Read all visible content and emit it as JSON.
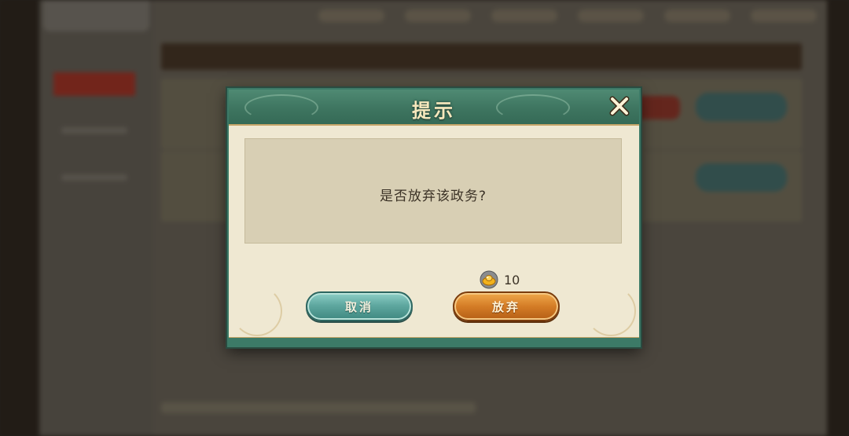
{
  "dialog": {
    "title": "提示",
    "message": "是否放弃该政务?",
    "cost": {
      "icon": "gold-ingot-icon",
      "amount": "10"
    },
    "buttons": {
      "cancel_label": "取消",
      "abandon_label": "放弃"
    }
  },
  "colors": {
    "header_green": "#3e7560",
    "parchment": "#efe8d2",
    "cancel_teal": "#5fa8a0",
    "abandon_orange": "#d47c26"
  }
}
